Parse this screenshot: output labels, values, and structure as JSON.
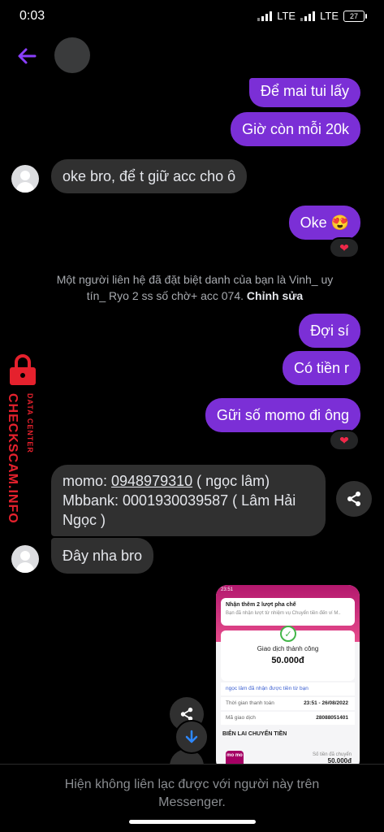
{
  "status_bar": {
    "time": "0:03",
    "net1": "LTE",
    "net2": "LTE",
    "battery": "27"
  },
  "messages": {
    "m1": "Để mai tui lấy",
    "m2": "Giờ còn mỗi 20k",
    "m3": "oke bro, để t giữ acc cho ô",
    "m4": "Oke 😍",
    "m4_reaction": "❤",
    "system_note": "Một người liên hệ đã đặt biệt danh của bạn là Vinh_ uy tín_ Ryo 2 ss số chờ+ acc 074.",
    "system_note_action": "Chỉnh sửa",
    "m5": "Đợi sí",
    "m6": "Có tiền r",
    "m7": "Gữi số momo đi ông",
    "m7_reaction": "❤",
    "m8_prefix": "momo: ",
    "m8_phone": "0948979310",
    "m8_suffix": " ( ngọc lâm)",
    "m8_line2": "Mbbank: 0001930039587 ( Lâm Hải Ngọc )",
    "m9": "Đây nha bro"
  },
  "watermark": {
    "brand": "CHECKSCAM.INFO",
    "sub": "DATA CENTER"
  },
  "thumbnail": {
    "status": "23:51",
    "notice_title": "Nhận thêm 2 lượt pha chế",
    "notice_sub": "Bạn đã nhận lượt từ nhiệm vụ Chuyển tiền đến ví M..",
    "success": "Giao dịch thành công",
    "amount": "50.000đ",
    "recipient_note": "ngọc lâm đã nhận được tiền từ bạn",
    "time_label": "Thời gian thanh toán",
    "time_value": "23:51 - 26/08/2022",
    "txn_label": "Mã giao dịch",
    "txn_value": "28088051401",
    "section": "BIÊN LAI CHUYỂN TIỀN",
    "momo_logo": "mo mo",
    "fee_label": "Số tiền đã chuyển",
    "fee_value": "50.000đ"
  },
  "footer": {
    "notice": "Hiện không liên lạc được với người này trên Messenger."
  },
  "colors": {
    "outgoing": "#7b2fd6",
    "incoming": "#303030",
    "accent": "#8a3ffc"
  }
}
